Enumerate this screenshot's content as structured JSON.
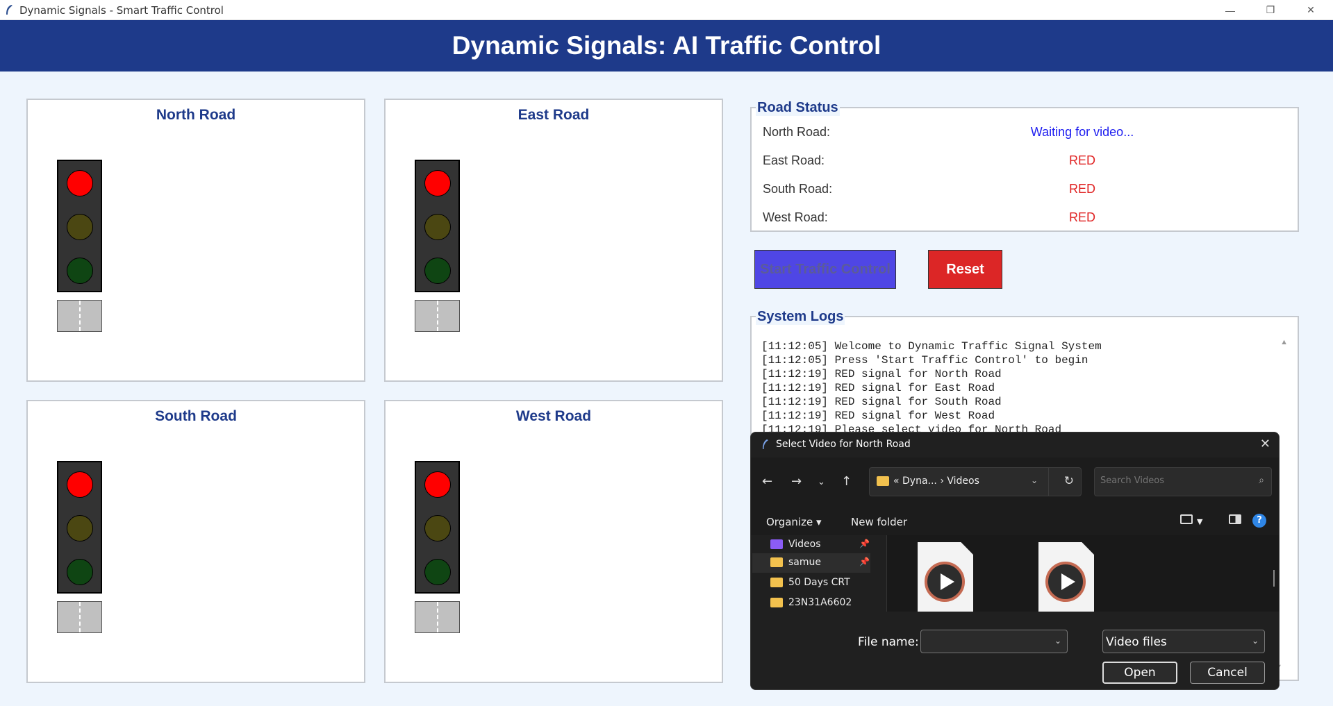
{
  "window": {
    "title": "Dynamic Signals - Smart Traffic Control",
    "controls": {
      "minimize": "—",
      "restore": "❐",
      "close": "✕"
    }
  },
  "header": {
    "title": "Dynamic Signals: AI Traffic Control"
  },
  "roads": [
    {
      "name": "North Road",
      "signal": "red"
    },
    {
      "name": "East Road",
      "signal": "red"
    },
    {
      "name": "South Road",
      "signal": "red"
    },
    {
      "name": "West Road",
      "signal": "red"
    }
  ],
  "status": {
    "legend": "Road Status",
    "rows": [
      {
        "label": "North Road:",
        "value": "Waiting for video...",
        "color": "#1d1df0"
      },
      {
        "label": "East Road:",
        "value": "RED",
        "color": "#e02424"
      },
      {
        "label": "South Road:",
        "value": "RED",
        "color": "#e02424"
      },
      {
        "label": "West Road:",
        "value": "RED",
        "color": "#e02424"
      }
    ]
  },
  "buttons": {
    "start": "Start Traffic Control",
    "reset": "Reset"
  },
  "logs": {
    "legend": "System Logs",
    "lines": [
      "[11:12:05] Welcome to Dynamic Traffic Signal System",
      "[11:12:05] Press 'Start Traffic Control' to begin",
      "[11:12:19] RED signal for North Road",
      "[11:12:19] RED signal for East Road",
      "[11:12:19] RED signal for South Road",
      "[11:12:19] RED signal for West Road",
      "[11:12:19] Please select video for North Road"
    ]
  },
  "dialog": {
    "title": "Select Video for North Road",
    "breadcrumb": "« Dyna...  ›  Videos",
    "search_placeholder": "Search Videos",
    "organize": "Organize ▾",
    "new_folder": "New folder",
    "nav_items": [
      {
        "label": "Videos",
        "icon": "videos-folder-icon"
      },
      {
        "label": "samue",
        "icon": "folder-icon"
      },
      {
        "label": "50 Days CRT",
        "icon": "folder-icon"
      },
      {
        "label": "23N31A6602",
        "icon": "folder-icon"
      }
    ],
    "file_name_label": "File name:",
    "file_name_value": "",
    "file_type": "Video files",
    "open": "Open",
    "cancel": "Cancel"
  },
  "colors": {
    "header": "#1e3a8a",
    "start_button": "#4f46e5",
    "reset_button": "#dc2626"
  }
}
